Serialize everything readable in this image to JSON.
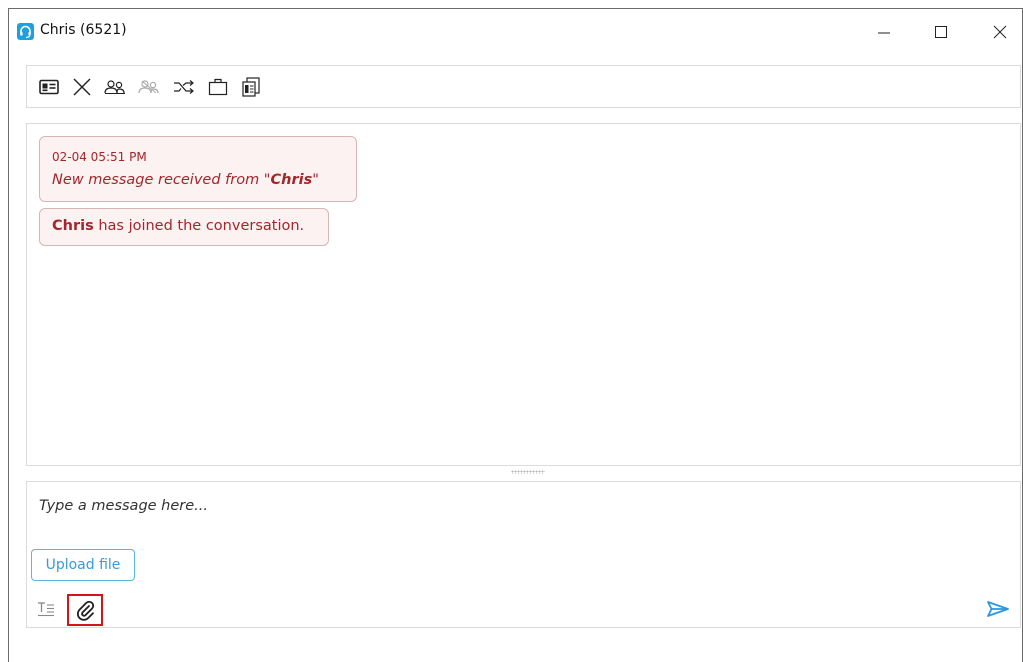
{
  "window": {
    "title": "Chris (6521)",
    "icon": "headset-icon",
    "controls": [
      "minimize-icon",
      "maximize-icon",
      "close-icon"
    ]
  },
  "toolbar": {
    "icons": [
      "contact-card-icon",
      "end-chat-icon",
      "transfer-agent-icon",
      "conference-icon",
      "route-icon",
      "wrapup-icon",
      "transcript-icon"
    ]
  },
  "conversation": {
    "messages": [
      {
        "timestamp": "02-04 05:51 PM",
        "prefix": "New message received from \"",
        "sender": "Chris",
        "suffix": "\""
      },
      {
        "name": "Chris",
        "text": " has joined the conversation."
      }
    ]
  },
  "compose": {
    "placeholder": "Type a message here...",
    "upload_label": "Upload file"
  },
  "colors": {
    "accent": "#1e9fe0",
    "message_text": "#a2272b",
    "message_bg": "#fdf2f2",
    "highlight_box": "#d2141c"
  }
}
